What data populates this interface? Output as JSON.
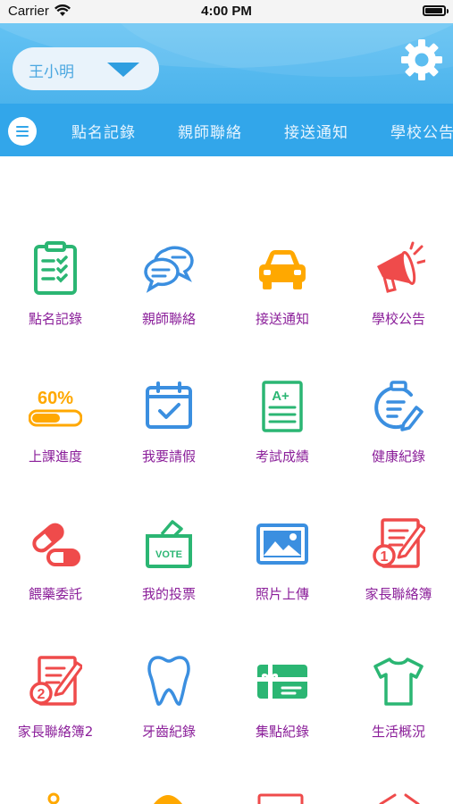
{
  "status": {
    "carrier": "Carrier",
    "time": "4:00 PM"
  },
  "header": {
    "user_name": "王小明"
  },
  "tabs": [
    "點名記錄",
    "親師聯絡",
    "接送通知",
    "學校公告"
  ],
  "grid": [
    {
      "label": "點名記錄",
      "icon": "clipboard-checklist-icon"
    },
    {
      "label": "親師聯絡",
      "icon": "chat-bubbles-icon"
    },
    {
      "label": "接送通知",
      "icon": "car-icon"
    },
    {
      "label": "學校公告",
      "icon": "megaphone-icon"
    },
    {
      "label": "上課進度",
      "icon": "progress-bar-icon",
      "badge": "60%",
      "progress": 0.6
    },
    {
      "label": "我要請假",
      "icon": "calendar-check-icon"
    },
    {
      "label": "考試成績",
      "icon": "grade-sheet-icon",
      "badge": "A+"
    },
    {
      "label": "健康紀錄",
      "icon": "health-clipboard-icon"
    },
    {
      "label": "餵藥委託",
      "icon": "medicine-capsule-icon"
    },
    {
      "label": "我的投票",
      "icon": "ballot-box-icon",
      "badge": "VOTE"
    },
    {
      "label": "照片上傳",
      "icon": "photo-icon"
    },
    {
      "label": "家長聯絡簿",
      "icon": "notebook-1-icon",
      "badge": "1"
    },
    {
      "label": "家長聯絡簿2",
      "icon": "notebook-2-icon",
      "badge": "2"
    },
    {
      "label": "牙齒紀錄",
      "icon": "tooth-icon"
    },
    {
      "label": "集點紀錄",
      "icon": "gift-card-icon"
    },
    {
      "label": "生活概況",
      "icon": "tshirt-icon"
    }
  ],
  "colors": {
    "header": "#4cb3ec",
    "tabbar": "#32a6ea",
    "label": "#8b1f9a",
    "green": "#2bb673",
    "blue": "#3b8fe0",
    "orange": "#ffa800",
    "red": "#ef4b4b"
  }
}
